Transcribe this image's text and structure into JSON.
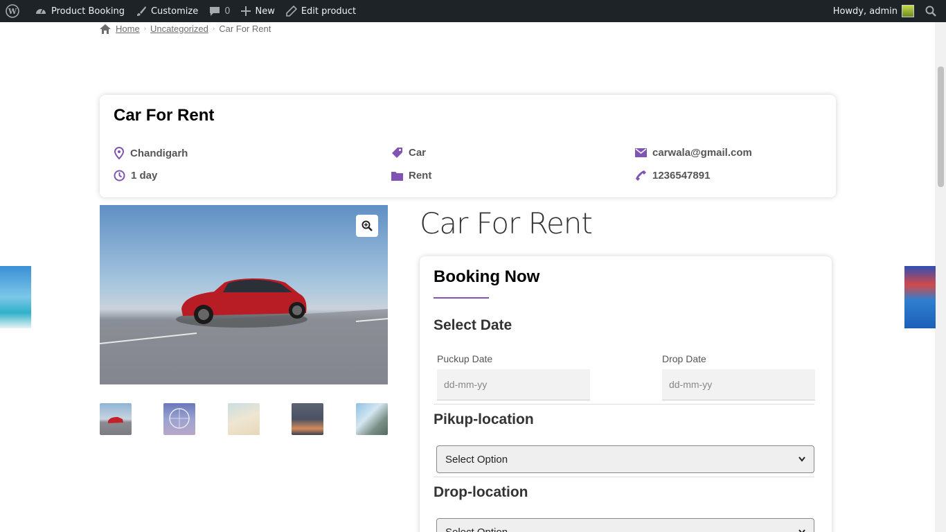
{
  "adminbar": {
    "site_name": "Product Booking",
    "customize": "Customize",
    "comments_count": "0",
    "new_label": "New",
    "edit_label": "Edit product",
    "howdy": "Howdy, admin"
  },
  "breadcrumb": {
    "home": "Home",
    "category": "Uncategorized",
    "current": "Car For Rent"
  },
  "info_card": {
    "title": "Car For Rent",
    "location": "Chandigarh",
    "duration": "1 day",
    "tag": "Car",
    "category": "Rent",
    "email": "carwala@gmail.com",
    "phone": "1236547891"
  },
  "product": {
    "title": "Car For Rent"
  },
  "booking": {
    "title": "Booking Now",
    "select_date": "Select Date",
    "pickup_date_label": "Puckup Date",
    "pickup_date_placeholder": "dd-mm-yy",
    "drop_date_label": "Drop Date",
    "drop_date_placeholder": "dd-mm-yy",
    "pickup_location_title": "Pikup-location",
    "pickup_location_value": "Select Option",
    "drop_location_title": "Drop-location",
    "drop_location_value": "Select Option"
  },
  "colors": {
    "accent": "#7f54b3",
    "adminbar": "#1d2327"
  },
  "icons": [
    "wordpress-icon",
    "dashboard-icon",
    "brush-icon",
    "comment-icon",
    "plus-icon",
    "pencil-icon",
    "search-icon",
    "home-icon",
    "location-icon",
    "clock-icon",
    "tag-icon",
    "folder-icon",
    "mail-icon",
    "phone-icon",
    "zoom-icon"
  ]
}
